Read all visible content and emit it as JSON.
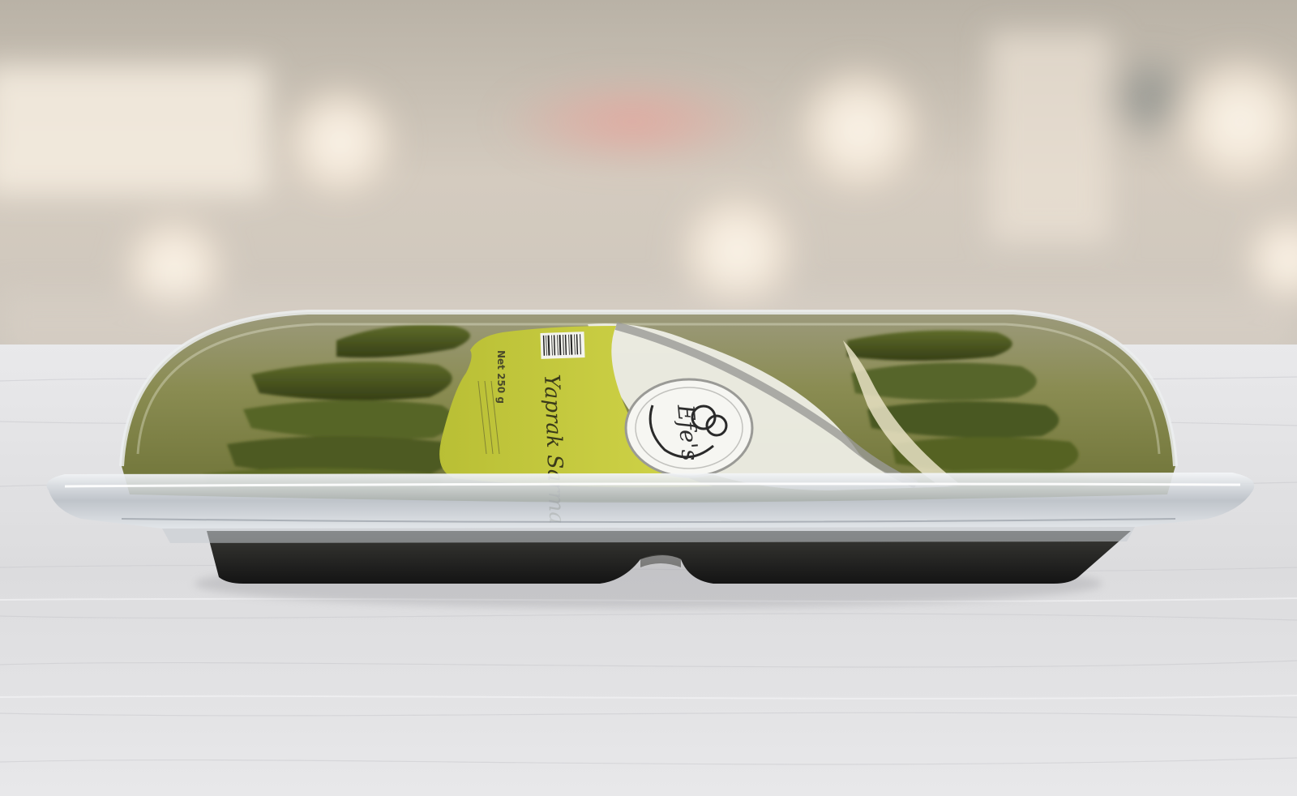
{
  "scene": {
    "subject": "vacuum-sealed-food-tray",
    "background": "blurred-bokeh-interior",
    "surface": "white-wooden-table"
  },
  "label": {
    "product_name": "Yaprak Sarma",
    "brand": "Efe's",
    "net_weight": "Net 250 g"
  },
  "colors": {
    "label_green": "#c8cc3c",
    "label_white": "#f2f2ec",
    "leaf_dark": "#4a5a1e",
    "tray_black": "#1c1c1c",
    "table_white": "#e4e4e6"
  },
  "icons": {
    "barcode": "barcode-icon",
    "logo": "brand-logo-icon"
  }
}
